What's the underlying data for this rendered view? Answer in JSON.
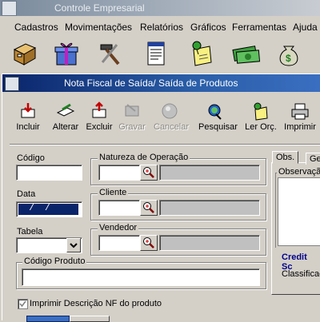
{
  "app": {
    "title": "Controle Empresarial"
  },
  "menu": {
    "items": [
      "Cadastros",
      "Movimentações",
      "Relatórios",
      "Gráficos",
      "Ferramentas",
      "Ajuda"
    ]
  },
  "toolbar": {
    "icons": [
      "file-cabinet-icon",
      "gift-box-icon",
      "tools-icon",
      "document-list-icon",
      "note-pin-icon",
      "money-icon",
      "money-bag-icon"
    ]
  },
  "child": {
    "title": "Nota Fiscal de Saída/ Saída de Produtos"
  },
  "actions": {
    "incluir": "Incluir",
    "alterar": "Alterar",
    "excluir": "Excluir",
    "gravar": "Gravar",
    "cancelar": "Cancelar",
    "pesquisar": "Pesquisar",
    "ler_orc": "Ler Orç.",
    "imprimir": "Imprimir"
  },
  "form": {
    "codigo_label": "Código",
    "codigo_value": "",
    "data_label": "Data",
    "data_value": "  /  /",
    "tabela_label": "Tabela",
    "tabela_value": "",
    "natureza_label": "Natureza de Operação",
    "cliente_label": "Cliente",
    "vendedor_label": "Vendedor",
    "codigo_produto_label": "Código Produto",
    "imprimir_desc_label": "Imprimir Descrição NF do produto",
    "imprimir_desc_checked": true
  },
  "tabs": {
    "obs": "Obs.",
    "ge": "Ge"
  },
  "side": {
    "observacao_label": "Observaçã",
    "credit_label": "Credit Sc",
    "classificacao_label": "Classificaç"
  },
  "colors": {
    "title_active": "#0a246a",
    "credit_text": "#00008b",
    "date_highlight": "#0a246a"
  }
}
